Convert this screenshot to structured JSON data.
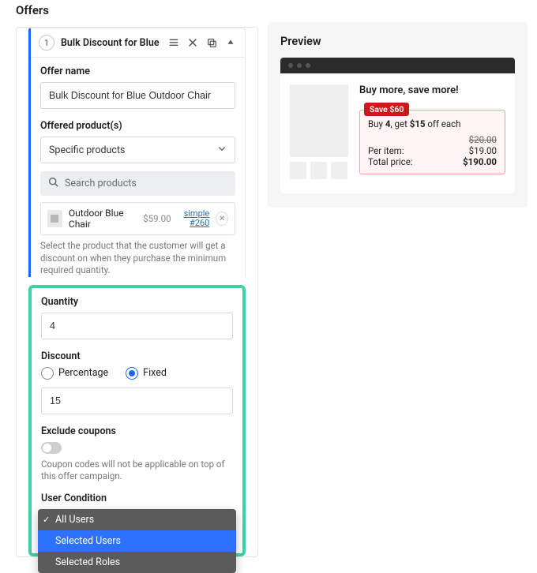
{
  "left": {
    "section_title": "Offers",
    "header": {
      "num": "1",
      "title": "Bulk Discount for Blue O"
    },
    "offer_name_label": "Offer name",
    "offer_name_value": "Bulk Discount for Blue Outdoor Chair",
    "offered_products_label": "Offered product(s)",
    "offered_products_select": "Specific products",
    "search_placeholder": "Search products",
    "product": {
      "name": "Outdoor Blue Chair",
      "price": "$59.00",
      "tag_top": "simple",
      "tag_bottom": "#260"
    },
    "products_help": "Select the product that the customer will get a discount on when they purchase the minimum required quantity.",
    "quantity_label": "Quantity",
    "quantity_value": "4",
    "discount_label": "Discount",
    "discount_radio_percentage": "Percentage",
    "discount_radio_fixed": "Fixed",
    "discount_value": "15",
    "exclude_label": "Exclude coupons",
    "exclude_help": "Coupon codes will not be applicable on top of this offer campaign.",
    "user_condition_label": "User Condition",
    "user_condition_options": {
      "all": "All Users",
      "selected_users": "Selected Users",
      "selected_roles": "Selected Roles"
    }
  },
  "right": {
    "heading": "Preview",
    "title": "Buy more, save more!",
    "badge": "Save $60",
    "buy_prefix": "Buy ",
    "buy_qty": "4",
    "buy_mid": ", get ",
    "buy_amt": "$15",
    "buy_suffix": " off each",
    "rows": {
      "strike": "$20.00",
      "per_item_label": "Per item:",
      "per_item_val": "$19.00",
      "total_label": "Total price:",
      "total_val": "$190.00"
    }
  }
}
